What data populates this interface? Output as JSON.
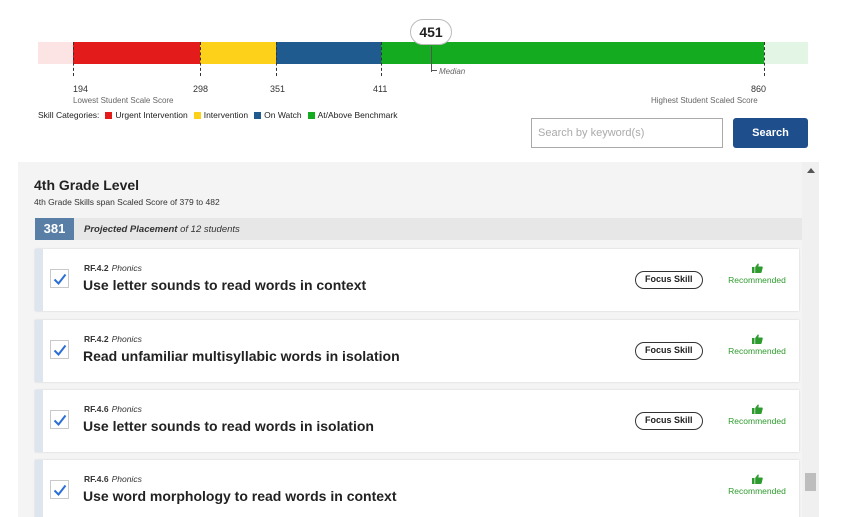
{
  "scale": {
    "categories": [
      {
        "name": "Urgent Intervention",
        "color": "#e31b1b",
        "from": 194,
        "to": 298
      },
      {
        "name": "Intervention",
        "color": "#fdd11a",
        "from": 298,
        "to": 351
      },
      {
        "name": "On Watch",
        "color": "#1f5b8f",
        "from": 351,
        "to": 411
      },
      {
        "name": "At/Above Benchmark",
        "color": "#14ab21",
        "from": 411,
        "to": 860
      }
    ],
    "ticks": {
      "lowest": "194",
      "t298": "298",
      "t351": "351",
      "t411": "411",
      "highest": "860"
    },
    "lowest_label": "Lowest Student Scale Score",
    "highest_label": "Highest Student Scaled Score",
    "median_value": "451",
    "median_label": "Median"
  },
  "legend": {
    "title": "Skill Categories:",
    "items": [
      "Urgent Intervention",
      "Intervention",
      "On Watch",
      "At/Above Benchmark"
    ],
    "colors": [
      "#e31b1b",
      "#fdd11a",
      "#1f5b8f",
      "#14ab21"
    ]
  },
  "search": {
    "placeholder": "Search by keyword(s)",
    "button_label": "Search"
  },
  "grade": {
    "title": "4th Grade Level",
    "subtitle": "4th Grade Skills span Scaled Score of 379 to 482",
    "placement_score": "381",
    "placement_label": "Projected Placement",
    "placement_suffix": "of 12 students"
  },
  "skills": [
    {
      "code": "RF.4.2",
      "domain": "Phonics",
      "title": "Use letter sounds to read words in context",
      "focus": "Focus Skill",
      "recommended": "Recommended"
    },
    {
      "code": "RF.4.2",
      "domain": "Phonics",
      "title": "Read unfamiliar multisyllabic words in isolation",
      "focus": "Focus Skill",
      "recommended": "Recommended"
    },
    {
      "code": "RF.4.6",
      "domain": "Phonics",
      "title": "Use letter sounds to read words in isolation",
      "focus": "Focus Skill",
      "recommended": "Recommended"
    },
    {
      "code": "RF.4.6",
      "domain": "Phonics",
      "title": "Use word morphology to read words in context",
      "recommended": "Recommended"
    }
  ]
}
